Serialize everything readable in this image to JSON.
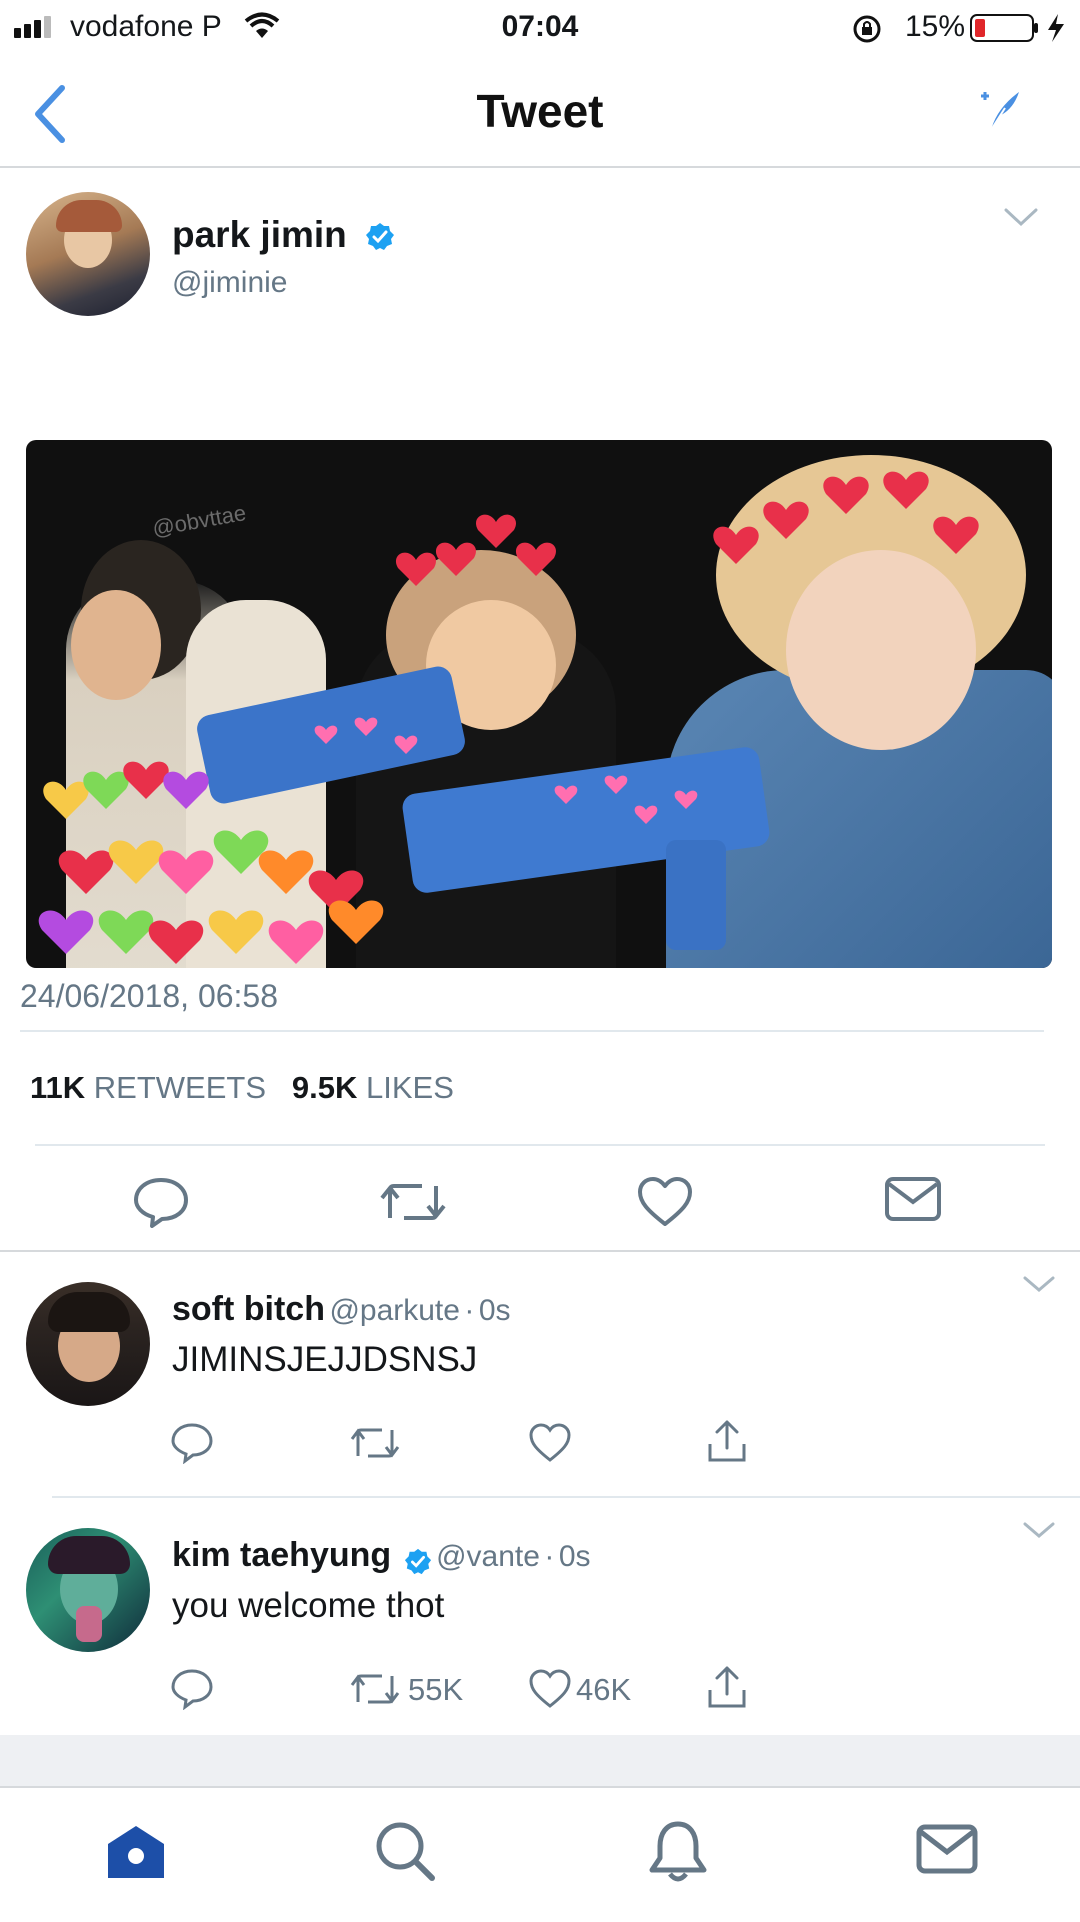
{
  "status_bar": {
    "carrier": "vodafone P",
    "time": "07:04",
    "battery": "15%"
  },
  "nav": {
    "title": "Tweet"
  },
  "tweet": {
    "author_name": "park jimin",
    "author_handle": "@jiminie",
    "image_watermark": "@obvttae",
    "timestamp": "24/06/2018, 06:58",
    "retweets_count": "11K",
    "retweets_label": "RETWEETS",
    "likes_count": "9.5K",
    "likes_label": "LIKES"
  },
  "replies": [
    {
      "name": "soft bitch",
      "handle": "@parkute",
      "time": "0s",
      "text": "JIMINSJEJJDSNSJ",
      "retweets": "",
      "likes": ""
    },
    {
      "name": "kim taehyung",
      "handle": "@vante",
      "time": "0s",
      "text": "you welcome thot",
      "retweets": "55K",
      "likes": "46K"
    }
  ],
  "colors": {
    "accent": "#4a90e2",
    "icon_gray": "#657786",
    "verified": "#1da1f2"
  }
}
